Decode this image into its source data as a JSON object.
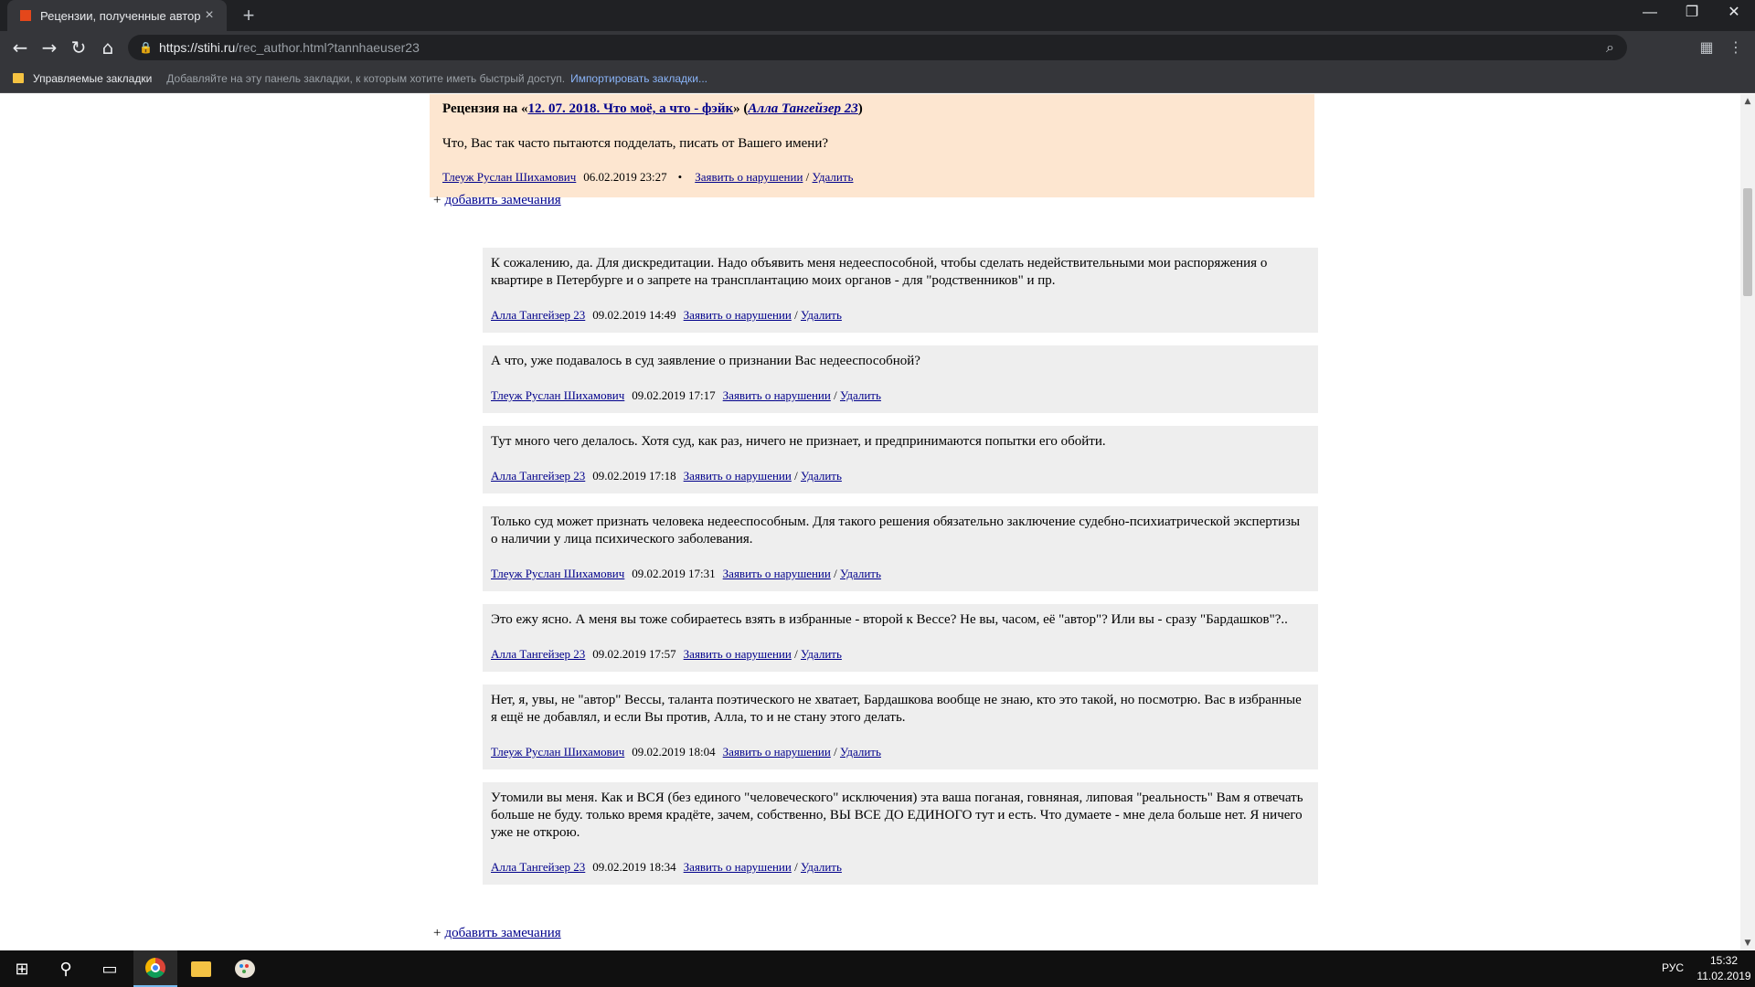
{
  "browser": {
    "tab_title": "Рецензии, полученные автором",
    "tab_close": "×",
    "new_tab": "+",
    "window_controls": {
      "minimize": "—",
      "restore": "❐",
      "close": "✕"
    },
    "url_host": "https://stihi.ru",
    "url_path": "/rec_author.html?tannhaeuser23",
    "nav": {
      "back": "←",
      "forward": "→",
      "reload": "↻",
      "home": "⌂"
    },
    "bookmarks_bar": {
      "managed": "Управляемые закладки",
      "hint": "Добавляйте на эту панель закладки, к которым хотите иметь быстрый доступ.",
      "import": "Импортировать закладки..."
    }
  },
  "review": {
    "heading_prefix": "Рецензия на «",
    "work_title": "12. 07. 2018. Что моё, а что - фэйк",
    "heading_mid": "» (",
    "work_author": "Алла Тангейзер 23",
    "heading_suffix": ")",
    "text": "Что, Вас так часто пытаются подделать, писать от Вашего имени?",
    "author": "Тлеуж Руслан Шихамович",
    "date": "06.02.2019 23:27",
    "bullet": "•",
    "report": "Заявить о нарушении",
    "slash": "/",
    "delete": "Удалить"
  },
  "add_note": {
    "plus": "+",
    "label": "добавить замечания"
  },
  "replies": [
    {
      "text": "К сожалению, да. Для дискредитации. Надо объявить меня недееспособной, чтобы сделать недействительными мои распоряжения о квартире в Петербурге и о запрете на трансплантацию моих органов - для \"родственников\" и пр.",
      "author": "Алла Тангейзер 23",
      "date": "09.02.2019 14:49",
      "report": "Заявить о нарушении",
      "slash": "/",
      "delete": "Удалить"
    },
    {
      "text": "А что, уже подавалось в суд заявление о признании Вас недееспособной?",
      "author": "Тлеуж Руслан Шихамович",
      "date": "09.02.2019 17:17",
      "report": "Заявить о нарушении",
      "slash": "/",
      "delete": "Удалить"
    },
    {
      "text": "Тут много чего делалось. Хотя суд, как раз, ничего не признает, и предпринимаются попытки его обойти.",
      "author": "Алла Тангейзер 23",
      "date": "09.02.2019 17:18",
      "report": "Заявить о нарушении",
      "slash": "/",
      "delete": "Удалить"
    },
    {
      "text": "Только суд может признать человека недееспособным. Для такого решения обязательно заключение судебно-психиатрической экспертизы о наличии у лица психического заболевания.",
      "author": "Тлеуж Руслан Шихамович",
      "date": "09.02.2019 17:31",
      "report": "Заявить о нарушении",
      "slash": "/",
      "delete": "Удалить"
    },
    {
      "text": "Это ежу ясно. А меня вы тоже собираетесь взять в избранные - второй к Вессе? Не вы, часом, её \"автор\"? Или вы - сразу \"Бардашков\"?..",
      "author": "Алла Тангейзер 23",
      "date": "09.02.2019 17:57",
      "report": "Заявить о нарушении",
      "slash": "/",
      "delete": "Удалить"
    },
    {
      "text": "Нет, я, увы, не \"автор\" Вессы, таланта поэтического не хватает, Бардашкова вообще не знаю, кто это такой, но посмотрю. Вас в избранные я ещё не добавлял, и если Вы против, Алла, то и не стану этого делать.",
      "author": "Тлеуж Руслан Шихамович",
      "date": "09.02.2019 18:04",
      "report": "Заявить о нарушении",
      "slash": "/",
      "delete": "Удалить"
    },
    {
      "text": "Утомили вы меня. Как и ВСЯ (без единого \"человеческого\" исключения) эта ваша поганая, говняная, липовая \"реальность\" Вам я отвечать больше не буду. только время крадёте, зачем, собственно, ВЫ ВСЕ ДО ЕДИНОГО тут и есть. Что думаете - мне дела больше нет. Я ничего уже не открою.",
      "author": "Алла Тангейзер 23",
      "date": "09.02.2019 18:34",
      "report": "Заявить о нарушении",
      "slash": "/",
      "delete": "Удалить"
    }
  ],
  "scrollbar": {
    "up": "▲",
    "down": "▼"
  },
  "taskbar": {
    "start": "⊞",
    "search": "⚲",
    "taskview": "▭",
    "language": "РУС",
    "time": "15:32",
    "date": "11.02.2019"
  }
}
